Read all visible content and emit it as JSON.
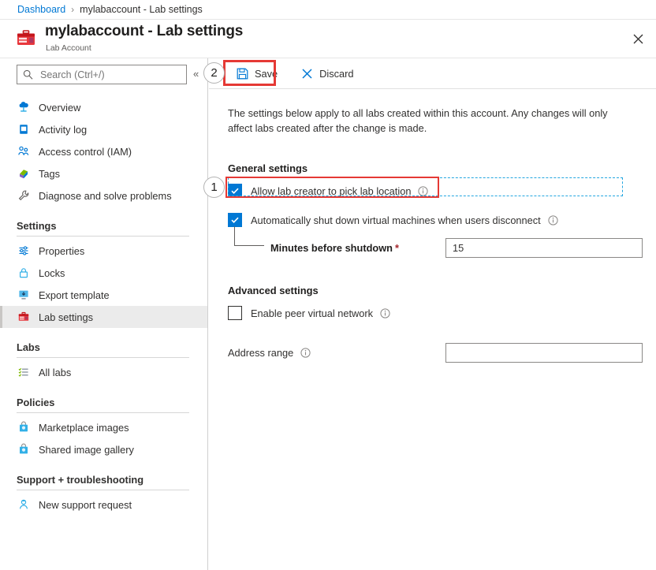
{
  "breadcrumb": {
    "root": "Dashboard",
    "separator": "›",
    "current": "mylabaccount - Lab settings"
  },
  "header": {
    "title": "mylabaccount - Lab settings",
    "subtitle": "Lab Account",
    "resource_icon": "lab-account-toolbox-icon",
    "close_icon": "close-icon",
    "close_label": "✕"
  },
  "sidebar": {
    "search": {
      "placeholder": "Search (Ctrl+/)",
      "icon": "search-icon",
      "value": ""
    },
    "collapse": {
      "icon": "collapse-chevron-icon",
      "glyph": "«"
    },
    "top_items": [
      {
        "label": "Overview",
        "icon": "overview-cloud-icon"
      },
      {
        "label": "Activity log",
        "icon": "activity-log-book-icon"
      },
      {
        "label": "Access control (IAM)",
        "icon": "access-control-people-icon"
      },
      {
        "label": "Tags",
        "icon": "tags-icon"
      },
      {
        "label": "Diagnose and solve problems",
        "icon": "wrench-icon"
      }
    ],
    "groups": [
      {
        "label": "Settings",
        "items": [
          {
            "label": "Properties",
            "icon": "properties-sliders-icon",
            "selected": false
          },
          {
            "label": "Locks",
            "icon": "lock-icon",
            "selected": false
          },
          {
            "label": "Export template",
            "icon": "export-template-icon",
            "selected": false
          },
          {
            "label": "Lab settings",
            "icon": "lab-settings-toolbox-icon",
            "selected": true
          }
        ]
      },
      {
        "label": "Labs",
        "items": [
          {
            "label": "All labs",
            "icon": "all-labs-list-icon",
            "selected": false
          }
        ]
      },
      {
        "label": "Policies",
        "items": [
          {
            "label": "Marketplace images",
            "icon": "marketplace-bag-icon",
            "selected": false
          },
          {
            "label": "Shared image gallery",
            "icon": "shared-gallery-bag-icon",
            "selected": false
          }
        ]
      },
      {
        "label": "Support + troubleshooting",
        "items": [
          {
            "label": "New support request",
            "icon": "support-person-icon",
            "selected": false
          }
        ]
      }
    ]
  },
  "commandbar": {
    "save": {
      "label": "Save",
      "icon": "save-floppy-icon"
    },
    "discard": {
      "label": "Discard",
      "icon": "discard-x-icon"
    }
  },
  "callouts": {
    "step1": "1",
    "step2": "2"
  },
  "main": {
    "intro": "The settings below apply to all labs created within this account. Any changes will only affect labs created after the change is made.",
    "general": {
      "title": "General settings",
      "allow_location": {
        "label": "Allow lab creator to pick lab location",
        "checked": true,
        "info_icon": "info-icon"
      },
      "auto_shutdown": {
        "label": "Automatically shut down virtual machines when users disconnect",
        "checked": true,
        "info_icon": "info-icon"
      },
      "minutes": {
        "label": "Minutes before shutdown",
        "required_marker": "*",
        "value": "15"
      }
    },
    "advanced": {
      "title": "Advanced settings",
      "peer_vnet": {
        "label": "Enable peer virtual network",
        "checked": false,
        "info_icon": "info-icon"
      },
      "address_range": {
        "label": "Address range",
        "value": "",
        "placeholder": "",
        "info_icon": "info-icon"
      }
    }
  },
  "colors": {
    "accent_blue": "#0078d4",
    "link_blue": "#0078d4",
    "highlight_red": "#e53935",
    "focus_dash": "#23a6e0",
    "required_red": "#a4262c",
    "selected_bg": "#ebebeb"
  }
}
